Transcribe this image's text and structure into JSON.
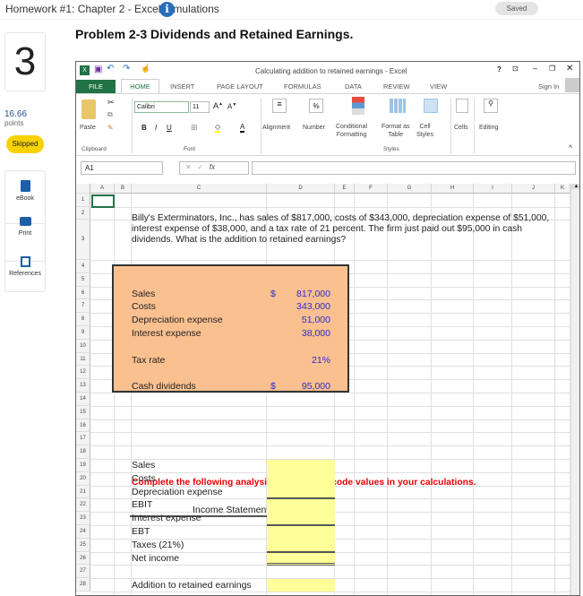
{
  "header": {
    "title": "Homework #1: Chapter 2 - Excel Simulations",
    "saved": "Saved"
  },
  "sidebar": {
    "question_number": "3",
    "points": "16.66",
    "points_label": "points",
    "status": "Skipped",
    "tools": [
      "eBook",
      "Print",
      "References"
    ]
  },
  "problem_title": "Problem 2-3 Dividends and Retained Earnings.",
  "excel": {
    "window_title": "Calculating addition to retained earnings - Excel",
    "sign_in": "Sign In",
    "tabs": [
      "FILE",
      "HOME",
      "INSERT",
      "PAGE LAYOUT",
      "FORMULAS",
      "DATA",
      "REVIEW",
      "VIEW"
    ],
    "ribbon": {
      "paste": "Paste",
      "font_name": "Calibri",
      "font_size": "11",
      "alignment": "Alignment",
      "number": "Number",
      "conditional": "Conditional",
      "formatting": "Formatting",
      "format_as": "Format as",
      "table": "Table",
      "cell": "Cell",
      "styles_btn": "Styles",
      "cells": "Cells",
      "editing": "Editing",
      "groups": [
        "Clipboard",
        "Font",
        "Styles"
      ]
    },
    "name_box": "A1",
    "fx": "fx",
    "columns": [
      "A",
      "B",
      "C",
      "D",
      "E",
      "F",
      "G",
      "H",
      "I",
      "J",
      "K"
    ],
    "problem_text": "Billy's Exterminators, Inc., has sales of $817,000, costs of $343,000, depreciation expense of $51,000, interest expense of $38,000, and a tax rate of 21 percent. The firm just paid out $95,000 in cash dividends. What is the addition to retained earnings?",
    "inputs": [
      {
        "label": "Sales",
        "currency": "$",
        "value": "817,000"
      },
      {
        "label": "Costs",
        "currency": "",
        "value": "343,000"
      },
      {
        "label": "Depreciation expense",
        "currency": "",
        "value": "51,000"
      },
      {
        "label": "Interest expense",
        "currency": "",
        "value": "38,000"
      },
      {
        "label": "Tax rate",
        "currency": "",
        "value": "21%"
      },
      {
        "label": "Cash dividends",
        "currency": "$",
        "value": "95,000"
      }
    ],
    "instruction": "Complete the following analysis. Do not hard code values in your calculations.",
    "income_statement": {
      "title": "Income Statement",
      "rows": [
        "Sales",
        "Costs",
        "Depreciation expense",
        "EBIT",
        "Interest expense",
        "EBT",
        "Taxes (21%)",
        "Net income"
      ],
      "addition": "Addition to retained earnings"
    }
  }
}
